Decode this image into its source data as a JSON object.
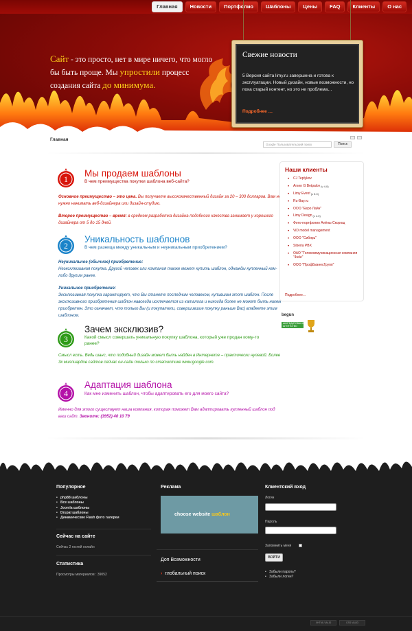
{
  "nav": {
    "items": [
      "Главная",
      "Новости",
      "Портфолио",
      "Шаблоны",
      "Цены",
      "FAQ",
      "Клиенты",
      "О нас"
    ],
    "active_index": 0
  },
  "hero": {
    "word1": "Сайт",
    "part1": " - это просто, нет в мире ничего, что могло бы быть проще. Мы ",
    "word2": "упростили",
    "part2": " процесс создания сайта ",
    "word3": "до минимума."
  },
  "news": {
    "title": "Свежие новости",
    "text": "5 Версия сайта limy.ru завершена и готова к эксплуатации. Новый дизайн, новые возможности, но пока старый контент, но это не проблема…",
    "more": "Подробнее …"
  },
  "breadcrumb": "Главная",
  "search": {
    "placeholder": "Google Пользовательский поиск",
    "button": "Поиск"
  },
  "sections": [
    {
      "number": "1",
      "title": "Мы продаем шаблоны",
      "subtitle": "В чем преимущества покупки шаблона веб-сайта?",
      "color": "#d8150b",
      "p1_bold": "Основное преимущество – это цена.",
      "p1": " Вы получаете высококачественный дизайн за 20 – 300 долларов. Вам не нужно нанимать веб-дизайнера или дизайн-студию.",
      "p2_bold": "Второе преимущество – время:",
      "p2": " в среднем разработка дизайна подобного качества занимает у хорошего дизайнера от 5 до 15 дней."
    },
    {
      "number": "2",
      "title": "Уникальность шаблонов",
      "subtitle": "В чем разница между уникальным и неуникальным приобретением?",
      "color": "#1a83c9",
      "p1_bold": "Неуникальное (обычное) приобретение:",
      "p1": "Неэксклюзивная покупка. Другой человек или компания также может купить шаблон, однажды купленный кем-либо другим ранее.",
      "p2_bold": "Уникальное приобретение:",
      "p2": "Эксклюзивная покупка гарантирует, что Вы станете последним человеком, купившим этот шаблон. После эксклюзивного приобретения шаблон навсегда исключается из каталога и никогда более не может быть никем приобретен. Это означает, что только Вы (и покупатели, совершившие покупку раньше Вас) владеете этим шаблоном."
    },
    {
      "number": "3",
      "title": "Зачем эксклюзив?",
      "subtitle": "Какой смысл совершать уникальную покупку шаблона, который уже продан кому-то ранее?",
      "color": "#2f9b18",
      "p1": "Смысл есть. Ведь шанс, что подобный дизайн может быть найден в Интернете – практически нулевой. Более 3к миллиардов сайтов сейчас он-лайн только по статистике www.google.com."
    },
    {
      "number": "4",
      "title": "Адаптация шаблона",
      "subtitle": "Как мне изменить шаблон, чтобы адаптировать его для моего сайта?",
      "color": "#b412a8",
      "p1": "Именно для этого существует наша компания, которая поможет Вам адаптировать купленный шаблон под ваш сайт.",
      "p1_bold_end": " Звоните: (3952) 40 10 79"
    }
  ],
  "clients": {
    "title": "Наши клиенты",
    "items": [
      {
        "name": "CJ Teplykov",
        "sup": ""
      },
      {
        "name": "Arsen G Betpalov",
        "sup": "(v 4.0)"
      },
      {
        "name": "Limy Event",
        "sup": "(v 5.0)"
      },
      {
        "name": "Ru-Bay.ru",
        "sup": ""
      },
      {
        "name": "ООО \"Евро Лайн\"",
        "sup": ""
      },
      {
        "name": "Limy Design",
        "sup": "(v 4.0)"
      },
      {
        "name": "Фото-портфолио Алёны Скорощ",
        "sup": ""
      },
      {
        "name": "ViD model management",
        "sup": ""
      },
      {
        "name": "ООО \"Сибирь\"",
        "sup": ""
      },
      {
        "name": "Siberia PBX",
        "sup": ""
      },
      {
        "name": "ОАО \"Телекоммуникационная компания \"4tele\"",
        "sup": ""
      },
      {
        "name": "ООО \"ПрофБизнесГрупп\"",
        "sup": ""
      }
    ],
    "more": "Подробнее..."
  },
  "begun": {
    "logo": "begun",
    "badge": "АККРЕДИТОВАННОЕ АГЕНТСТВО"
  },
  "footer": {
    "popular_title": "Популярное",
    "popular_items": [
      "php88 шаблоны",
      "Все шаблоны",
      "Joomla шаблоны",
      "Drupal шаблоны",
      "Динамические Flash фото галереи"
    ],
    "online_title": "Сейчас на сайте",
    "online_text": "Сейчас 2 гостей онлайн",
    "stats_title": "Статистика",
    "stats_text": "Просмотры материалов : 39052",
    "ads_title": "Реклама",
    "ad_text1": "choose website ",
    "ad_text2": "шаблон",
    "extra_title": "Доп Возможности",
    "extra_link": "глобальный поиск",
    "login_title": "Клиентский вход",
    "login_label": "Логин",
    "password_label": "Пароль",
    "remember_label": "Запомнить меня",
    "login_button": "ВОЙТИ",
    "links": [
      "Забыли пароль?",
      "Забыли логин?"
    ],
    "valid1": "XHTML VALID",
    "valid2": "CSS VALID"
  }
}
